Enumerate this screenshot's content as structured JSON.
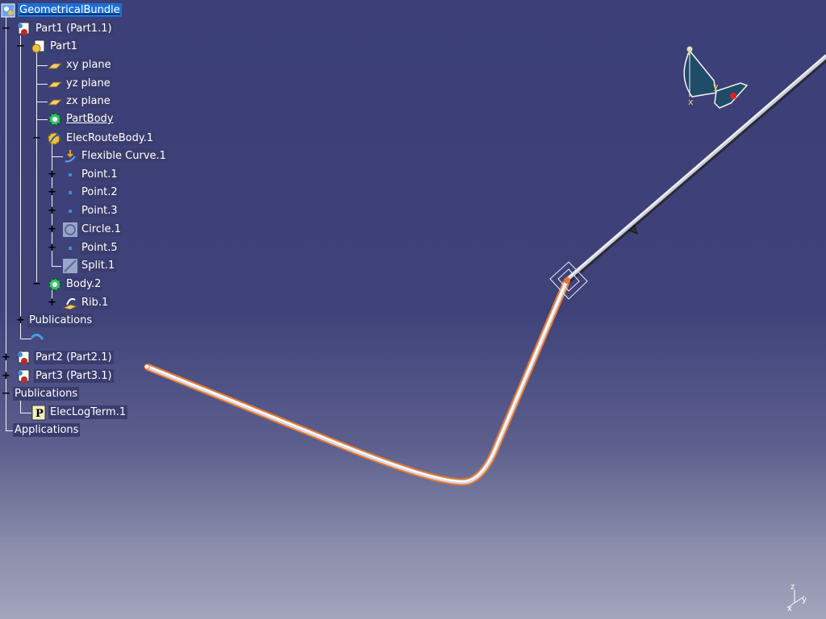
{
  "tree": {
    "root": {
      "label": "GeometricalBundle"
    },
    "items": [
      {
        "label": "Part1 (Part1.1)",
        "expander": "−"
      },
      {
        "label": "Part1",
        "expander": "−"
      },
      {
        "label": "xy plane"
      },
      {
        "label": "yz plane"
      },
      {
        "label": "zx plane"
      },
      {
        "label": "PartBody"
      },
      {
        "label": "ElecRouteBody.1",
        "expander": "−"
      },
      {
        "label": "Flexible Curve.1"
      },
      {
        "label": "Point.1",
        "expander": "+"
      },
      {
        "label": "Point.2",
        "expander": "+"
      },
      {
        "label": "Point.3",
        "expander": "+"
      },
      {
        "label": "Circle.1",
        "expander": "+"
      },
      {
        "label": "Point.5",
        "expander": "+"
      },
      {
        "label": "Split.1"
      },
      {
        "label": "Body.2",
        "expander": "−"
      },
      {
        "label": "Rib.1",
        "expander": "+"
      },
      {
        "label": "Publications",
        "expander": "+"
      },
      {
        "label": "Part2 (Part2.1)",
        "expander": "+"
      },
      {
        "label": "Part3 (Part3.1)",
        "expander": "+"
      },
      {
        "label": "Publications",
        "expander": "−"
      },
      {
        "label": "ElecLogTerm.1"
      },
      {
        "label": "Applications"
      }
    ]
  },
  "compass": {
    "axis_x": "x",
    "axis_y": "y",
    "axis_z": "z"
  },
  "axis_triad": {
    "axis_x": "x",
    "axis_y": "y",
    "axis_z": "z"
  },
  "colors": {
    "background_top": "#3c3f78",
    "background_bottom": "#a3a5bd",
    "selection": "#1b6fd6",
    "bundle_highlight": "#e8792a",
    "tree_line": "#f2f2f2"
  },
  "icons": {
    "product": "product-icon",
    "part": "part-icon",
    "plane": "plane-icon",
    "body": "gear-body-icon",
    "point": "point-icon",
    "curve": "flexible-curve-icon"
  }
}
